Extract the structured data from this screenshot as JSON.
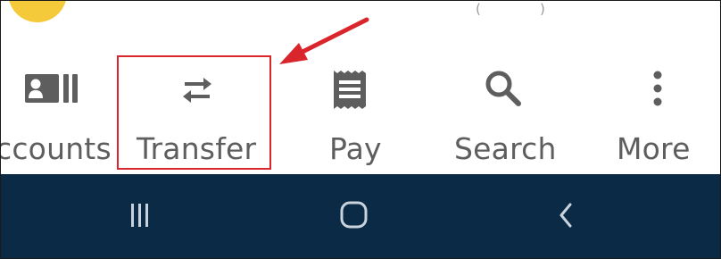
{
  "top_bar": {
    "partial_text_1": "(",
    "partial_text_2": ")"
  },
  "tabs": [
    {
      "label": "ccounts",
      "icon": "accounts-icon",
      "full_label": "Accounts"
    },
    {
      "label": "Transfer",
      "icon": "transfer-icon"
    },
    {
      "label": "Pay",
      "icon": "pay-icon"
    },
    {
      "label": "Search",
      "icon": "search-icon"
    },
    {
      "label": "More",
      "icon": "more-vertical-icon"
    }
  ],
  "annotation": {
    "highlighted_tab": "Transfer",
    "color": "#d9262c"
  },
  "system_nav": {
    "buttons": [
      "recent-apps-icon",
      "home-icon",
      "back-icon"
    ]
  },
  "colors": {
    "tab_text": "#5e5e5e",
    "tab_icon": "#5e5e5e",
    "nav_background": "#0b2a45",
    "nav_icon": "#c9d3dd",
    "avatar": "#f4c93a"
  }
}
